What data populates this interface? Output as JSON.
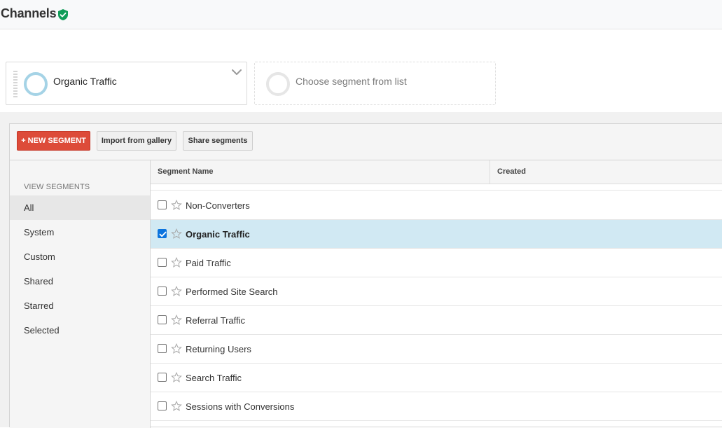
{
  "header": {
    "title": "Channels",
    "verified_icon": "verified-shield-icon",
    "verified_color": "#0f9d58"
  },
  "segment_bar": {
    "active_segment": {
      "label": "Organic Traffic",
      "ring_color": "#a5d3e6"
    },
    "empty_slot": {
      "placeholder": "Choose segment from list"
    }
  },
  "toolbar": {
    "new_segment_label": "+ NEW SEGMENT",
    "new_segment_color": "#dd4b39",
    "import_label": "Import from gallery",
    "share_label": "Share segments"
  },
  "side_nav": {
    "heading": "VIEW SEGMENTS",
    "items": [
      {
        "label": "All",
        "active": true
      },
      {
        "label": "System",
        "active": false
      },
      {
        "label": "Custom",
        "active": false
      },
      {
        "label": "Shared",
        "active": false
      },
      {
        "label": "Starred",
        "active": false
      },
      {
        "label": "Selected",
        "active": false
      }
    ]
  },
  "table": {
    "columns": [
      "Segment Name",
      "Created"
    ],
    "rows": [
      {
        "name": "Non-Converters",
        "checked": false,
        "starred": false
      },
      {
        "name": "Organic Traffic",
        "checked": true,
        "starred": false
      },
      {
        "name": "Paid Traffic",
        "checked": false,
        "starred": false
      },
      {
        "name": "Performed Site Search",
        "checked": false,
        "starred": false
      },
      {
        "name": "Referral Traffic",
        "checked": false,
        "starred": false
      },
      {
        "name": "Returning Users",
        "checked": false,
        "starred": false
      },
      {
        "name": "Search Traffic",
        "checked": false,
        "starred": false
      },
      {
        "name": "Sessions with Conversions",
        "checked": false,
        "starred": false
      }
    ],
    "selected_row_color": "#d1e9f3"
  }
}
